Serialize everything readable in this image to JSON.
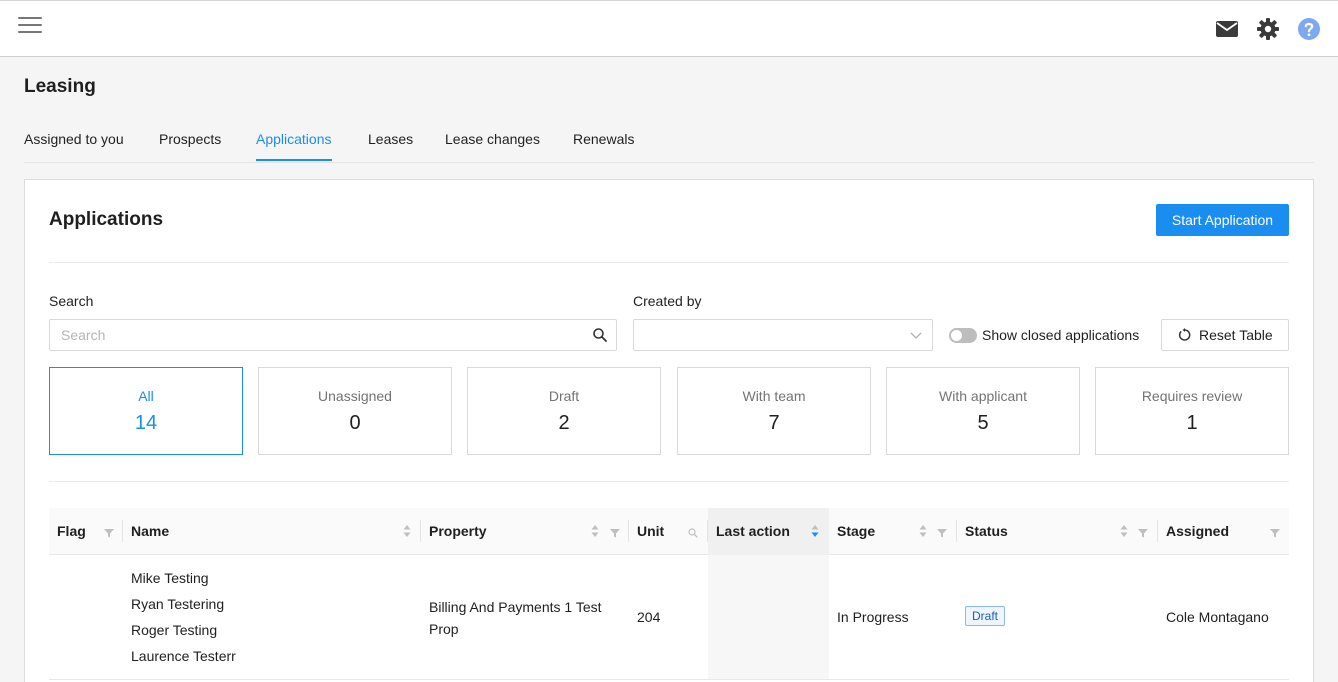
{
  "topbar": {
    "menu_icon": "hamburger-menu-icon",
    "icons": [
      "mail-icon",
      "gear-icon",
      "help-icon"
    ]
  },
  "page": {
    "title": "Leasing"
  },
  "tabs": [
    {
      "label": "Assigned to you",
      "active": false
    },
    {
      "label": "Prospects",
      "active": false
    },
    {
      "label": "Applications",
      "active": true
    },
    {
      "label": "Leases",
      "active": false
    },
    {
      "label": "Lease changes",
      "active": false
    },
    {
      "label": "Renewals",
      "active": false
    }
  ],
  "card": {
    "title": "Applications",
    "start_button": "Start Application"
  },
  "filters": {
    "search_label": "Search",
    "search_placeholder": "Search",
    "created_by_label": "Created by",
    "created_by_value": "",
    "show_closed_label": "Show closed applications",
    "show_closed_on": false,
    "reset_label": "Reset Table"
  },
  "stats": [
    {
      "label": "All",
      "count": "14",
      "active": true
    },
    {
      "label": "Unassigned",
      "count": "0",
      "active": false
    },
    {
      "label": "Draft",
      "count": "2",
      "active": false
    },
    {
      "label": "With team",
      "count": "7",
      "active": false
    },
    {
      "label": "With applicant",
      "count": "5",
      "active": false
    },
    {
      "label": "Requires review",
      "count": "1",
      "active": false
    }
  ],
  "table": {
    "columns": [
      {
        "label": "Flag"
      },
      {
        "label": "Name"
      },
      {
        "label": "Property"
      },
      {
        "label": "Unit"
      },
      {
        "label": "Last action"
      },
      {
        "label": "Stage"
      },
      {
        "label": "Status"
      },
      {
        "label": "Assigned"
      }
    ],
    "rows": [
      {
        "flag": "",
        "names": [
          "Mike Testing",
          "Ryan Testering",
          "Roger Testing",
          "Laurence Testerr"
        ],
        "property": "Billing And Payments 1 Test Prop",
        "unit": "204",
        "last_action": "",
        "stage": "In Progress",
        "status": "Draft",
        "assigned": "Cole Montagano"
      }
    ]
  },
  "colors": {
    "accent": "#1a8ef0",
    "border": "#d9d9d9",
    "muted_text": "#737373"
  }
}
